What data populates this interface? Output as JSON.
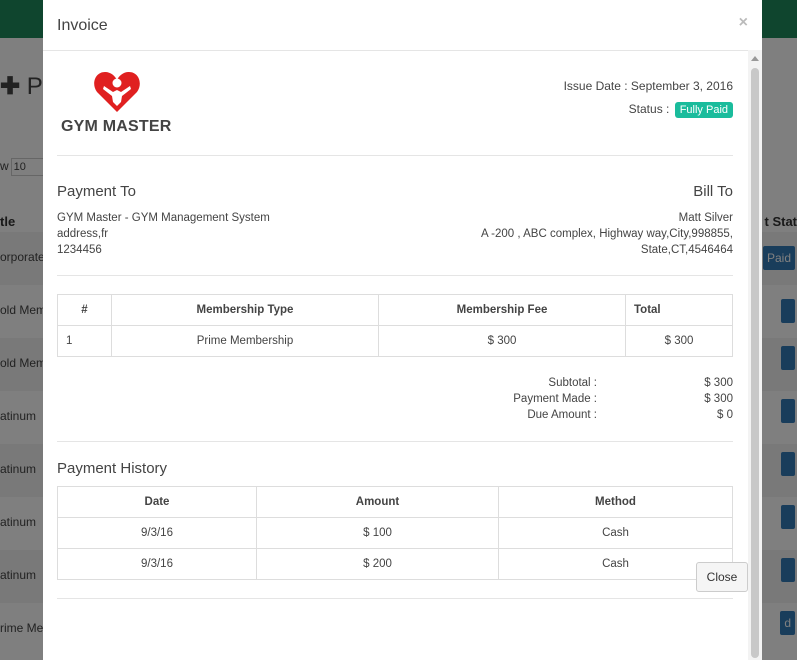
{
  "background": {
    "page_title": "Pay",
    "show_label": "w",
    "show_value": "10",
    "col_left": "tle",
    "col_right": "t Stat",
    "rows": [
      {
        "label": "orporate",
        "badge": "Paid"
      },
      {
        "label": "old Mem",
        "badge": ""
      },
      {
        "label": "old Mem",
        "badge": ""
      },
      {
        "label": "atinum",
        "badge": ""
      },
      {
        "label": "atinum",
        "badge": ""
      },
      {
        "label": "atinum",
        "badge": ""
      },
      {
        "label": "atinum",
        "badge": ""
      },
      {
        "label": "rime Me",
        "badge": "d"
      }
    ]
  },
  "modal": {
    "title": "Invoice",
    "close_icon": "×",
    "logo": {
      "text": "GYM MASTER",
      "icon": "heart-figure-icon",
      "color": "#e02020"
    },
    "issue_date": "Issue Date : September 3, 2016",
    "status_label": "Status :",
    "status_badge": "Fully Paid",
    "status_color": "#1abc9c",
    "payment_to": {
      "heading": "Payment To",
      "lines": [
        "GYM Master - GYM Management System",
        "address,fr",
        "1234456"
      ]
    },
    "bill_to": {
      "heading": "Bill To",
      "lines": [
        "Matt Silver",
        "A -200 , ABC complex, Highway way,City,998855,",
        "State,CT,4546464"
      ]
    },
    "items_table": {
      "headers": [
        "#",
        "Membership Type",
        "Membership Fee",
        "Total"
      ],
      "rows": [
        [
          "1",
          "Prime Membership",
          "$ 300",
          "$ 300"
        ]
      ]
    },
    "totals": [
      {
        "label": "Subtotal :",
        "value": "$ 300"
      },
      {
        "label": "Payment Made :",
        "value": "$ 300"
      },
      {
        "label": "Due Amount :",
        "value": "$ 0"
      }
    ],
    "history": {
      "heading": "Payment History",
      "headers": [
        "Date",
        "Amount",
        "Method"
      ],
      "rows": [
        [
          "9/3/16",
          "$ 100",
          "Cash"
        ],
        [
          "9/3/16",
          "$ 200",
          "Cash"
        ]
      ]
    },
    "close_button": "Close"
  }
}
